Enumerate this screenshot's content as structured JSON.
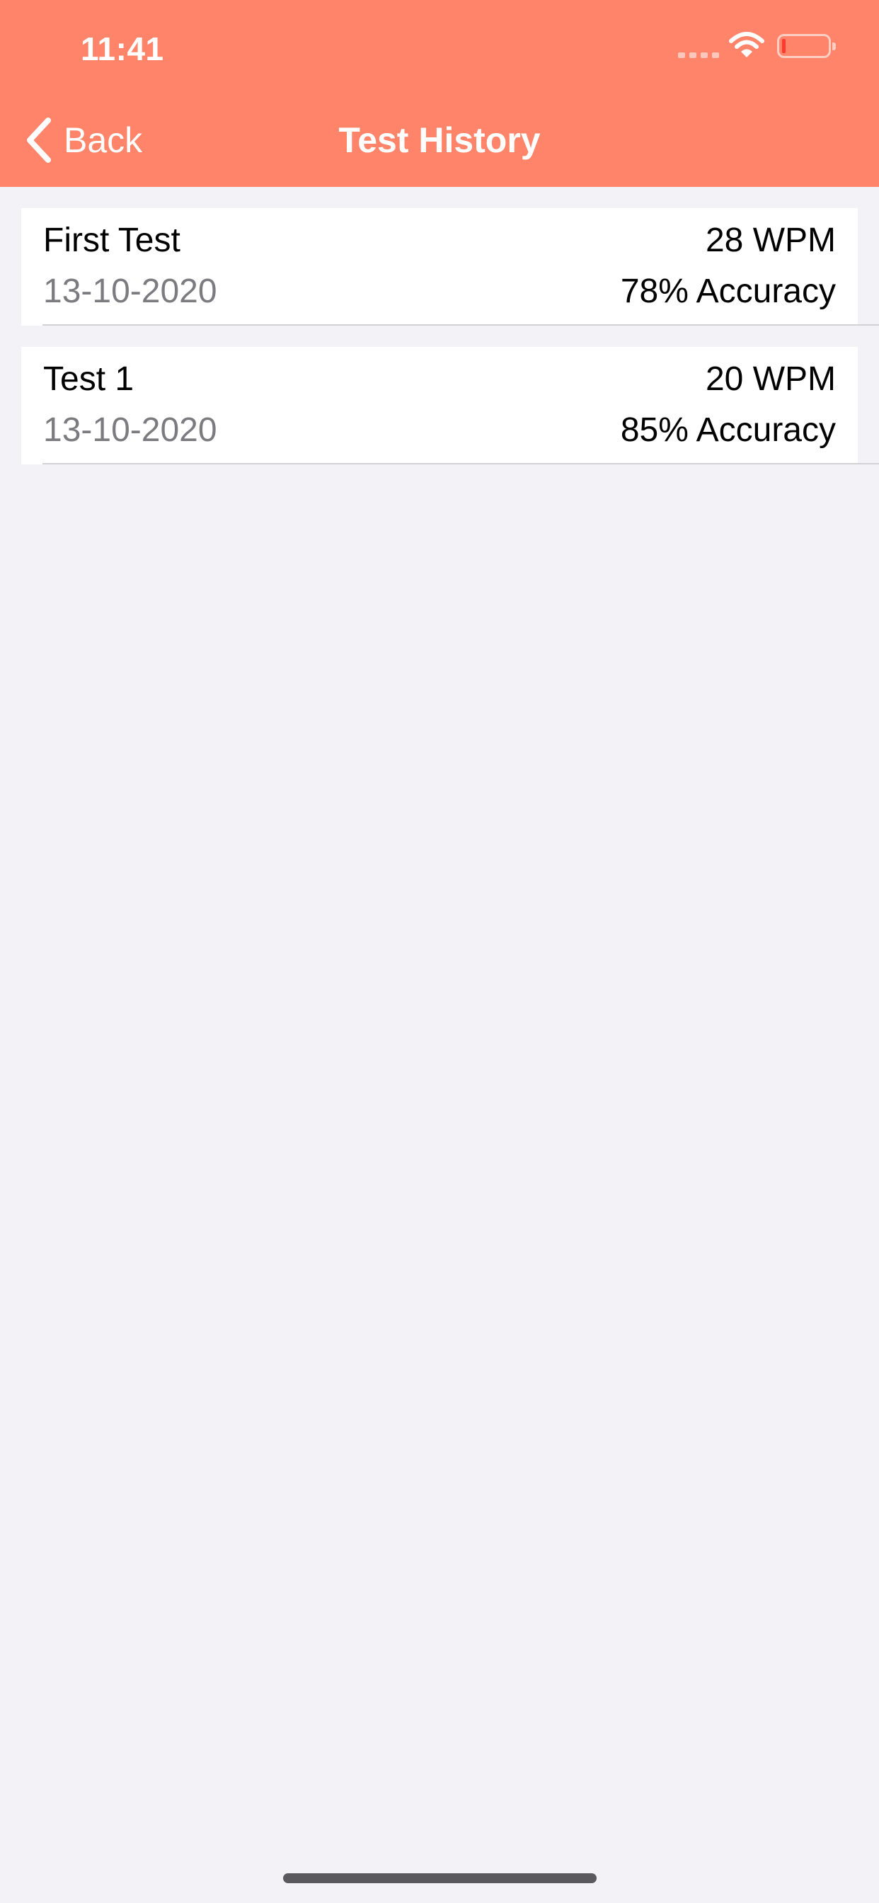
{
  "status_bar": {
    "time": "11:41"
  },
  "nav": {
    "back_label": "Back",
    "title": "Test History"
  },
  "history": [
    {
      "title": "First Test",
      "date": "13-10-2020",
      "wpm": "28 WPM",
      "accuracy": "78% Accuracy"
    },
    {
      "title": "Test 1",
      "date": "13-10-2020",
      "wpm": "20 WPM",
      "accuracy": "85% Accuracy"
    }
  ],
  "colors": {
    "header": "#ff8469",
    "background": "#f2f2f7",
    "secondary_text": "#7b7b80"
  },
  "icons": {
    "back": "chevron-left-icon",
    "wifi": "wifi-icon",
    "battery": "battery-icon",
    "signal": "signal-icon"
  }
}
